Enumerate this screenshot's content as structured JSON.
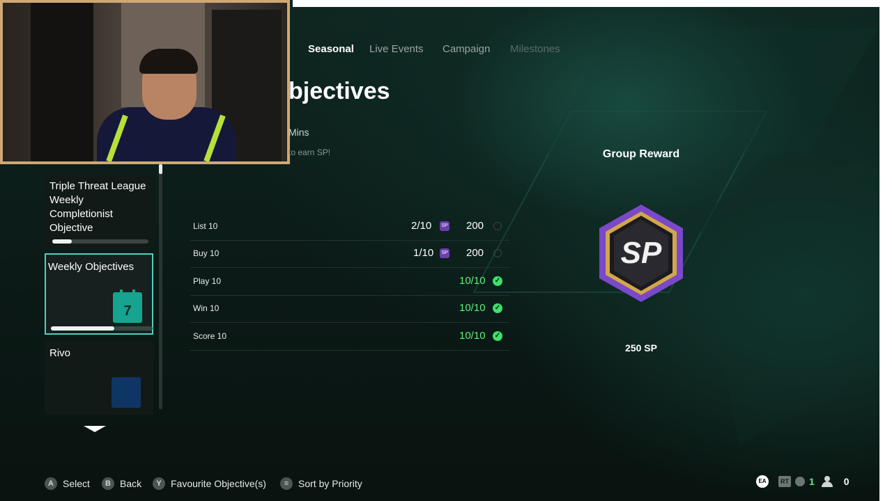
{
  "tabs": [
    {
      "label": "Seasonal",
      "state": "active"
    },
    {
      "label": "Live Events",
      "state": "normal"
    },
    {
      "label": "Campaign",
      "state": "normal"
    },
    {
      "label": "Milestones",
      "state": "dim"
    }
  ],
  "header": {
    "title_visible": "bjectives",
    "time_visible": "Mins",
    "hint_visible": "to earn SP!"
  },
  "sidebar": {
    "items": [
      {
        "label": "Triple Threat League Weekly Completionist Objective",
        "progress": 0.2,
        "selected": false
      },
      {
        "label": "Weekly Objectives",
        "progress": 0.62,
        "selected": true,
        "icon": "calendar-icon",
        "icon_text": "7"
      },
      {
        "label": "Rivo",
        "progress": null,
        "selected": false,
        "icon": "calendar-icon"
      }
    ]
  },
  "objectives": [
    {
      "name": "List 10",
      "progress": "2/10",
      "reward": "200",
      "completed": false
    },
    {
      "name": "Buy 10",
      "progress": "1/10",
      "reward": "200",
      "completed": false
    },
    {
      "name": "Play 10",
      "progress": "10/10",
      "reward": "",
      "completed": true
    },
    {
      "name": "Win 10",
      "progress": "10/10",
      "reward": "",
      "completed": true
    },
    {
      "name": "Score 10",
      "progress": "10/10",
      "reward": "",
      "completed": true
    }
  ],
  "group_reward": {
    "title": "Group Reward",
    "badge_text": "SP",
    "amount": "250 SP"
  },
  "sp_icon_text": "SP",
  "bottom_actions": [
    {
      "key": "A",
      "label": "Select"
    },
    {
      "key": "B",
      "label": "Back"
    },
    {
      "key": "Y",
      "label": "Favourite Objective(s)"
    },
    {
      "key": "≡",
      "label": "Sort by Priority"
    }
  ],
  "status": {
    "ea_label": "EA",
    "rt_label": "RT",
    "count_one": "1",
    "friends_count": "0"
  },
  "colors": {
    "accent_green": "#5ef07a",
    "selection_border": "#4fd1c1",
    "sp_purple": "#6b3fb0"
  }
}
